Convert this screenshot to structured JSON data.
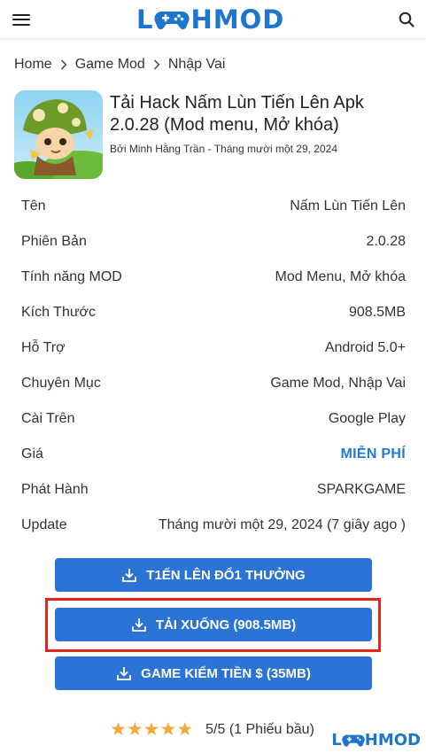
{
  "header": {
    "logo_left": "L",
    "logo_right": "HMOD",
    "menu_icon": "hamburger-icon",
    "search_icon": "search-icon"
  },
  "breadcrumb": [
    "Home",
    "Game Mod",
    "Nhập Vai"
  ],
  "app": {
    "title": "Tải Hack Nấm Lùn Tiến Lên Apk 2.0.28 (Mod menu, Mở khóa)",
    "byline": "Bởi Minh Hằng Trần - Tháng mười một 29, 2024"
  },
  "info": [
    {
      "label": "Tên",
      "value": "Nấm Lùn Tiến Lên"
    },
    {
      "label": "Phiên Bản",
      "value": "2.0.28"
    },
    {
      "label": "Tính năng MOD",
      "value": "Mod Menu, Mở khóa"
    },
    {
      "label": "Kích Thước",
      "value": "908.5MB"
    },
    {
      "label": "Hỗ Trợ",
      "value": "Android 5.0+"
    },
    {
      "label": "Chuyên Mục",
      "value": "Game Mod, Nhập Vai"
    },
    {
      "label": "Cài Trên",
      "value": "Google Play"
    },
    {
      "label": "Giá",
      "value": "MIỄN PHÍ"
    },
    {
      "label": "Phát Hành",
      "value": "SPARKGAME"
    },
    {
      "label": "Update",
      "value": "Tháng mười một 29, 2024 (7 giây ago )"
    }
  ],
  "buttons": {
    "btn1": "T1ẾN LÊN ĐỔ1 THƯỞNG",
    "btn2": "TẢI XUỐNG (908.5MB)",
    "btn3": "GAME KIẾM TIỀN $ (35MB)",
    "icon": "download-icon"
  },
  "colors": {
    "button": "#2b73d5",
    "highlight": "#e3241b",
    "free": "#1f7bd6",
    "star": "#f2a93b"
  },
  "rating": {
    "stars": 5,
    "text": "5/5 (1 Phiếu bầu)"
  },
  "watermark": {
    "left": "L",
    "right": "HMOD"
  }
}
